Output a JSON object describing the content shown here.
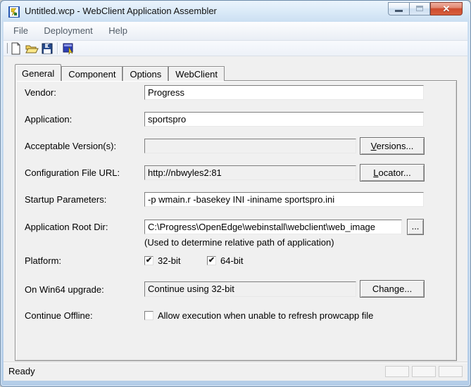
{
  "window": {
    "title": "Untitled.wcp - WebClient Application Assembler"
  },
  "glyphs": {
    "close": "✕",
    "check": "✔"
  },
  "menu": {
    "items": [
      "File",
      "Deployment",
      "Help"
    ]
  },
  "toolbar": {
    "buttons": [
      {
        "icon": "new-document-icon"
      },
      {
        "icon": "open-icon"
      },
      {
        "icon": "save-icon"
      },
      {
        "icon": "assemble-icon"
      }
    ]
  },
  "tabs": {
    "items": [
      "General",
      "Component",
      "Options",
      "WebClient"
    ],
    "active": "General"
  },
  "form": {
    "vendor": {
      "label": "Vendor:",
      "value": "Progress"
    },
    "application": {
      "label": "Application:",
      "value": "sportspro"
    },
    "acceptable_versions": {
      "label": "Acceptable Version(s):",
      "value": "",
      "button": {
        "u": "V",
        "rest": "ersions..."
      }
    },
    "config_file_url": {
      "label": "Configuration File URL:",
      "value": "http://nbwyles2:81",
      "button": {
        "u": "L",
        "rest": "ocator..."
      }
    },
    "startup_params": {
      "label": "Startup Parameters:",
      "value": "-p wmain.r -basekey INI -ininame sportspro.ini"
    },
    "app_root_dir": {
      "label": "Application Root Dir:",
      "value": "C:\\Progress\\OpenEdge\\webinstall\\webclient\\web_image",
      "browse_label": "...",
      "note": "(Used to determine relative path of application)"
    },
    "platform": {
      "label": "Platform:",
      "options": [
        {
          "label": "32-bit",
          "checked": true
        },
        {
          "label": "64-bit",
          "checked": true
        }
      ]
    },
    "win64_upgrade": {
      "label": "On Win64 upgrade:",
      "value": "Continue using 32-bit",
      "button_label": "Change..."
    },
    "continue_offline": {
      "label": "Continue Offline:",
      "checkbox_label": "Allow execution when unable to refresh prowcapp file",
      "checked": false
    }
  },
  "statusbar": {
    "text": "Ready"
  }
}
